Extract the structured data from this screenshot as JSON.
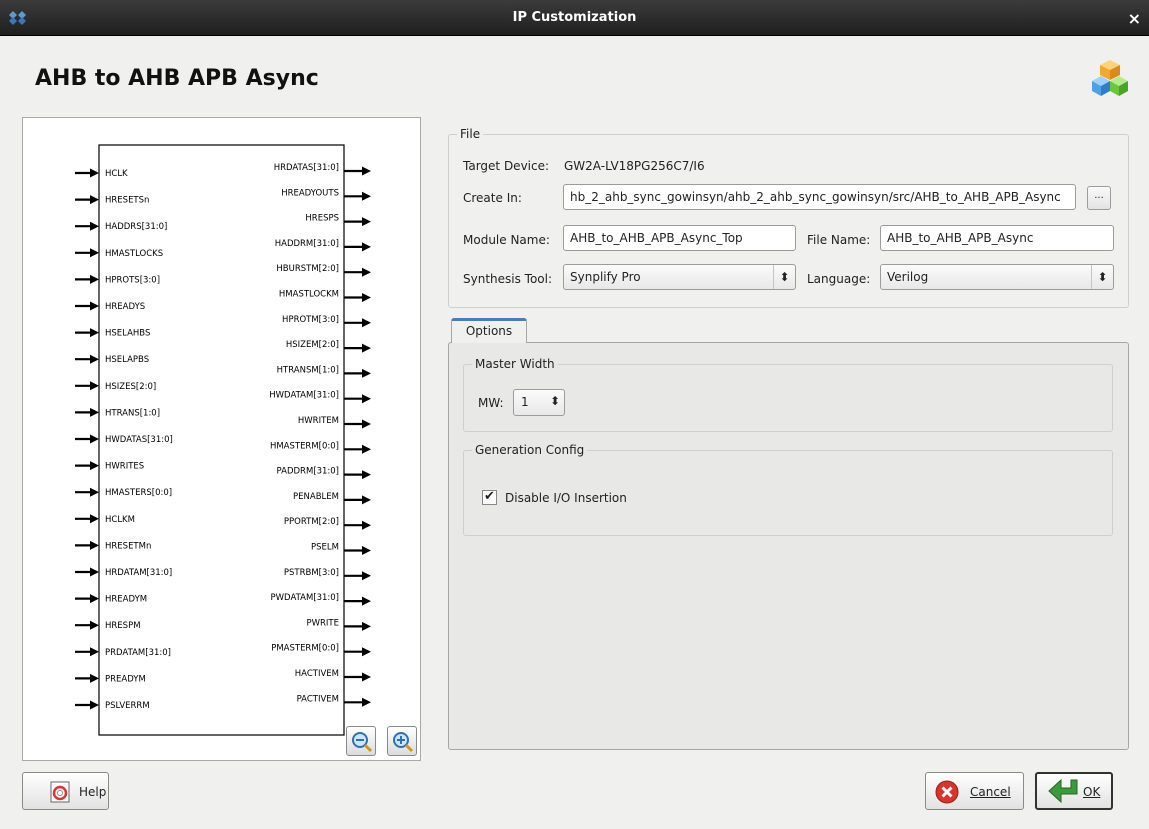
{
  "window": {
    "title": "IP Customization",
    "close_glyph": "×"
  },
  "header": {
    "title": "AHB to AHB APB Async",
    "logo_icon": "ip-cubes-icon"
  },
  "diagram": {
    "inputs": [
      "HCLK",
      "HRESETSn",
      "HADDRS[31:0]",
      "HMASTLOCKS",
      "HPROTS[3:0]",
      "HREADYS",
      "HSELAHBS",
      "HSELAPBS",
      "HSIZES[2:0]",
      "HTRANS[1:0]",
      "HWDATAS[31:0]",
      "HWRITES",
      "HMASTERS[0:0]",
      "HCLKM",
      "HRESETMn",
      "HRDATAM[31:0]",
      "HREADYM",
      "HRESPM",
      "PRDATAM[31:0]",
      "PREADYM",
      "PSLVERRM"
    ],
    "outputs": [
      "HRDATAS[31:0]",
      "HREADYOUTS",
      "HRESPS",
      "HADDRM[31:0]",
      "HBURSTM[2:0]",
      "HMASTLOCKM",
      "HPROTM[3:0]",
      "HSIZEM[2:0]",
      "HTRANSM[1:0]",
      "HWDATAM[31:0]",
      "HWRITEM",
      "HMASTERM[0:0]",
      "PADDRM[31:0]",
      "PENABLEM",
      "PPORTM[2:0]",
      "PSELM",
      "PSTRBM[3:0]",
      "PWDATAM[31:0]",
      "PWRITE",
      "PMASTERM[0:0]",
      "HACTIVEM",
      "PACTIVEM"
    ],
    "zoom_out_icon": "zoom-out-icon",
    "zoom_in_icon": "zoom-in-icon"
  },
  "file_group": {
    "legend": "File",
    "target_device_label": "Target Device:",
    "target_device_value": "GW2A-LV18PG256C7/I6",
    "create_in_label": "Create In:",
    "create_in_value": "hb_2_ahb_sync_gowinsyn/ahb_2_ahb_sync_gowinsyn/src/AHB_to_AHB_APB_Async",
    "browse_label": "...",
    "module_name_label": "Module Name:",
    "module_name_value": "AHB_to_AHB_APB_Async_Top",
    "file_name_label": "File Name:",
    "file_name_value": "AHB_to_AHB_APB_Async",
    "synthesis_tool_label": "Synthesis Tool:",
    "synthesis_tool_value": "Synplify Pro",
    "language_label": "Language:",
    "language_value": "Verilog"
  },
  "options_tab": {
    "label": "Options",
    "master_width": {
      "legend": "Master Width",
      "mw_label": "MW:",
      "mw_value": "1"
    },
    "generation_config": {
      "legend": "Generation Config",
      "disable_io_label": "Disable I/O Insertion",
      "disable_io_checked": true,
      "check_glyph": "✔"
    }
  },
  "buttons": {
    "help": "Help",
    "cancel": "Cancel",
    "ok": "OK"
  },
  "colors": {
    "tab_accent": "#4a7db5",
    "titlebar": "#2a2a2a",
    "cancel_red": "#d9342b",
    "ok_green": "#3c9a3c"
  }
}
